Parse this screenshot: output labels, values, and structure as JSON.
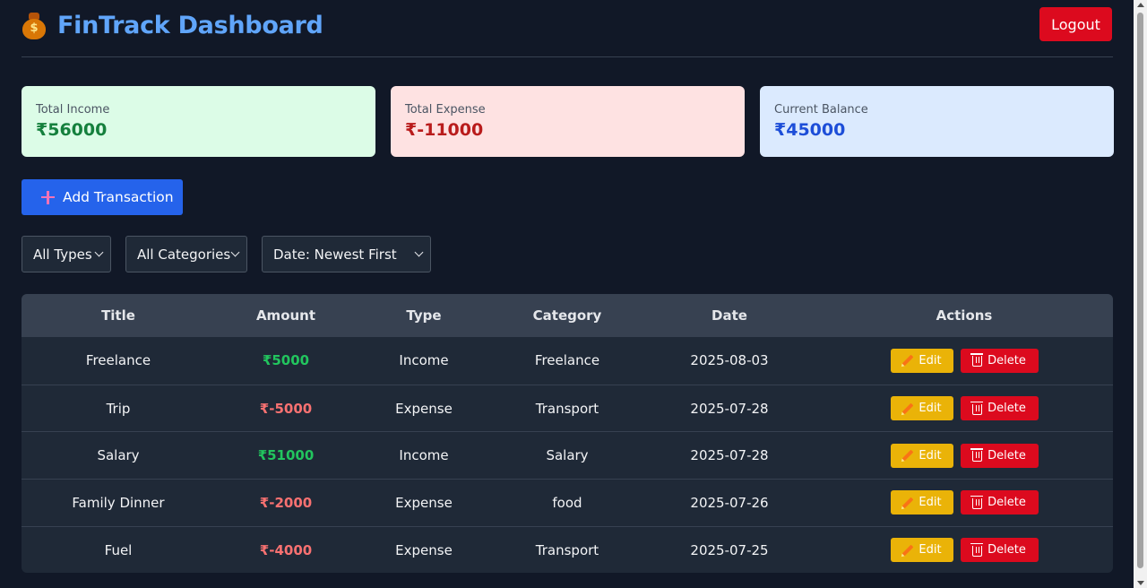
{
  "header": {
    "title": "FinTrack Dashboard",
    "icon": "money-bag-icon",
    "logout_label": "Logout"
  },
  "summary": {
    "income_label": "Total Income",
    "income_value": "₹56000",
    "expense_label": "Total Expense",
    "expense_value": "₹-11000",
    "balance_label": "Current Balance",
    "balance_value": "₹45000"
  },
  "add_transaction_label": "Add Transaction",
  "filters": {
    "type": "All Types",
    "category": "All Categories",
    "sort": "Date: Newest First"
  },
  "table": {
    "columns": [
      "Title",
      "Amount",
      "Type",
      "Category",
      "Date",
      "Actions"
    ],
    "edit_label": "Edit",
    "delete_label": "Delete",
    "rows": [
      {
        "title": "Freelance",
        "amount": "₹5000",
        "type": "Income",
        "category": "Freelance",
        "date": "2025-08-03"
      },
      {
        "title": "Trip",
        "amount": "₹-5000",
        "type": "Expense",
        "category": "Transport",
        "date": "2025-07-28"
      },
      {
        "title": "Salary",
        "amount": "₹51000",
        "type": "Income",
        "category": "Salary",
        "date": "2025-07-28"
      },
      {
        "title": "Family Dinner",
        "amount": "₹-2000",
        "type": "Expense",
        "category": "food",
        "date": "2025-07-26"
      },
      {
        "title": "Fuel",
        "amount": "₹-4000",
        "type": "Expense",
        "category": "Transport",
        "date": "2025-07-25"
      }
    ]
  },
  "colors": {
    "background": "#111827",
    "brand": "#60a5fa",
    "danger": "#dc0a1e",
    "primary": "#2563eb",
    "warning": "#eab308",
    "income": "#22c55e",
    "expense": "#f87171"
  }
}
